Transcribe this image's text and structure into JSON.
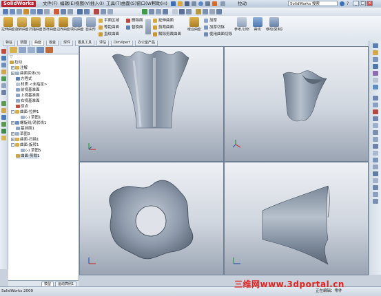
{
  "app": {
    "logo": "SolidWorks",
    "document_title": "拉动",
    "search_placeholder": "SolidWorks 搜索"
  },
  "menu": [
    "文件(F)",
    "编辑(E)",
    "视图(V)",
    "插入(I)",
    "工具(T)",
    "曲面(S)",
    "窗口(W)",
    "帮助(H)"
  ],
  "window_controls": [
    "_",
    "□",
    "×"
  ],
  "command_manager": {
    "big_buttons": [
      "拉伸曲面",
      "旋转曲面",
      "扫描曲面",
      "放样曲面",
      "边界曲面",
      "填充曲面",
      "自由形"
    ],
    "small_buttons_col1": [
      "平面区域",
      "等距曲面",
      "直纹曲面"
    ],
    "small_buttons_col2": [
      "删除面",
      "替换面"
    ],
    "small_buttons_col3": [
      "延伸曲面",
      "剪裁曲面",
      "解除剪裁曲面"
    ],
    "big_buttons_2": [
      "缝合曲面"
    ],
    "small_buttons_col4": [
      "加厚",
      "加厚切除",
      "使用曲面切除"
    ],
    "big_buttons_3": [
      "参考几何体",
      "曲线",
      "移动/复制实体"
    ]
  },
  "tabs": [
    "特征",
    "草图",
    "曲面",
    "钣金",
    "焊件",
    "模具工具",
    "评估",
    "DimXpert",
    "办公室产品"
  ],
  "active_tab_index": 2,
  "feature_tree": [
    {
      "label": "拉动",
      "indent": 0,
      "expand": ""
    },
    {
      "label": "注解",
      "indent": 1,
      "expand": "+"
    },
    {
      "label": "曲面实体(3)",
      "indent": 1,
      "expand": "+"
    },
    {
      "label": "方程式",
      "indent": 1,
      "expand": ""
    },
    {
      "label": "材质 <未指定>",
      "indent": 1,
      "expand": ""
    },
    {
      "label": "前视基准面",
      "indent": 1,
      "expand": ""
    },
    {
      "label": "上视基准面",
      "indent": 1,
      "expand": ""
    },
    {
      "label": "右视基准面",
      "indent": 1,
      "expand": ""
    },
    {
      "label": "原点",
      "indent": 1,
      "expand": ""
    },
    {
      "label": "曲面-拉伸1",
      "indent": 1,
      "expand": "-"
    },
    {
      "label": "(-) 草图1",
      "indent": 2,
      "expand": ""
    },
    {
      "label": "螺旋线/涡状线1",
      "indent": 1,
      "expand": "+"
    },
    {
      "label": "基准面1",
      "indent": 1,
      "expand": ""
    },
    {
      "label": "草图3",
      "indent": 1,
      "expand": "+"
    },
    {
      "label": "曲面-扫描1",
      "indent": 1,
      "expand": "+"
    },
    {
      "label": "曲面-旋转1",
      "indent": 1,
      "expand": "-"
    },
    {
      "label": "(-) 草图5",
      "indent": 2,
      "expand": ""
    },
    {
      "label": "曲面-剪裁1",
      "indent": 1,
      "expand": ""
    }
  ],
  "bottom_tabs": [
    "模型",
    "运动算例1"
  ],
  "status": {
    "left": "SolidWorks 2009",
    "right": "正在编辑：零件"
  },
  "watermark": "三维网www.3dportal.cn",
  "colors": {
    "brand_red": "#b8232f",
    "viewport_top": "#eef1f5",
    "viewport_bottom": "#9aa4b3",
    "model": "#8a97a8",
    "watermark": "#e0251f"
  }
}
